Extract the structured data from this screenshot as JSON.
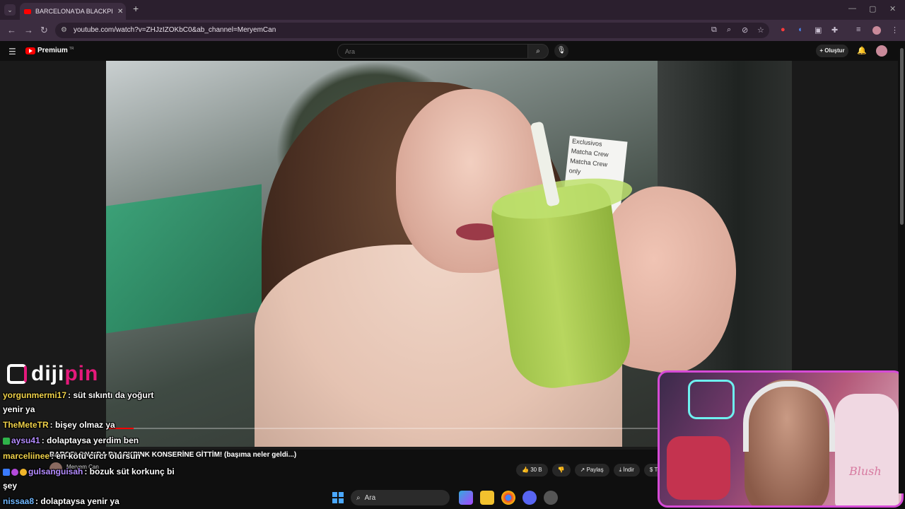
{
  "browser": {
    "tab_title": "BARCELONA'DA BLACKPINK KO",
    "url": "youtube.com/watch?v=ZHJzIZOKbC0&ab_channel=MeryemCan"
  },
  "youtube": {
    "logo_text": "Premium",
    "logo_region": "TR",
    "search_placeholder": "Ara",
    "create_label": "Oluştur",
    "progress_fraction": 0.05
  },
  "video": {
    "poster_lines": [
      "Exclusivos",
      "Matcha Crew",
      "Matcha Crew",
      "only"
    ],
    "title": "BARCELONA'DA BLACKPINK KONSERİNE GİTTİM! (başıma neler geldi...)",
    "channel": "Meryem Can",
    "likes": "30 B",
    "share_label": "Paylaş",
    "download_label": "İndir",
    "more_label": "Te"
  },
  "overlay": {
    "brand_a": "diji",
    "brand_b": "pin",
    "chat": [
      {
        "user": "yorgunmermi17",
        "text": ": süt sıkıntı da yoğurt",
        "color": "#f0d24a"
      },
      {
        "user": "",
        "text": "yenir ya",
        "color": "#ffffff"
      },
      {
        "user": "TheMeteTR",
        "text": ": bişey olmaz ya",
        "color": "#f0d24a"
      },
      {
        "user": "aysu41",
        "text": ": dolaptaysa yerdim ben",
        "color": "#b48cff"
      },
      {
        "user": "marceliinee",
        "text": ": en kötü circr olursun",
        "color": "#f0d24a"
      },
      {
        "user": "gulsanguisah",
        "text": ": bozuk süt korkunç bi",
        "color": "#b48cff"
      },
      {
        "user": "",
        "text": "şey",
        "color": "#ffffff"
      },
      {
        "user": "nissaa8",
        "text": ": dolaptaysa yenir ya",
        "color": "#6fb7ff"
      }
    ],
    "cam_chair_text": "Blush"
  },
  "taskbar": {
    "search_label": "Ara"
  }
}
